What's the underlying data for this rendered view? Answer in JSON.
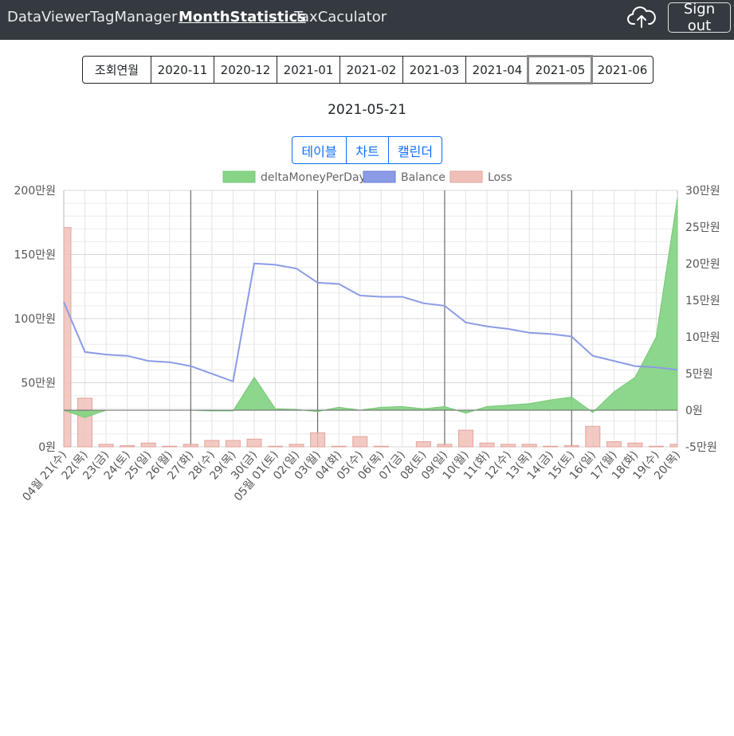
{
  "nav": {
    "links": [
      "DataViewer",
      "TagManager",
      "MonthStatistics",
      "TaxCaculator"
    ],
    "active": "MonthStatistics",
    "upload_icon": "cloud-upload-icon",
    "signout_label": "Sign out"
  },
  "months": {
    "label": "조회연월",
    "items": [
      "2020-11",
      "2020-12",
      "2021-01",
      "2021-02",
      "2021-03",
      "2021-04",
      "2021-05",
      "2021-06"
    ],
    "selected": "2021-05"
  },
  "date_title": "2021-05-21",
  "view_tabs": [
    "테이블",
    "차트",
    "캘린더"
  ],
  "colors": {
    "navbar": "#343a40",
    "delta": "#87d487",
    "balance": "#8b9be6",
    "loss": "#f0c0b8",
    "link": "#0d6efd"
  },
  "chart_data": {
    "type": "line",
    "categories": [
      "04월 21(수)",
      "22(목)",
      "23(금)",
      "24(토)",
      "25(일)",
      "26(월)",
      "27(화)",
      "28(수)",
      "29(목)",
      "30(금)",
      "05월 01(토)",
      "02(일)",
      "03(월)",
      "04(화)",
      "05(수)",
      "06(목)",
      "07(금)",
      "08(토)",
      "09(일)",
      "10(월)",
      "11(화)",
      "12(수)",
      "13(목)",
      "14(금)",
      "15(토)",
      "16(일)",
      "17(월)",
      "18(화)",
      "19(수)",
      "20(목)"
    ],
    "legend": [
      "deltaMoneyPerDay",
      "Balance",
      "Loss"
    ],
    "legend_position": "top",
    "left_axis": {
      "ticks": [
        "0원",
        "50만원",
        "100만원",
        "150만원",
        "200만원"
      ],
      "range": [
        0,
        200
      ]
    },
    "right_axis": {
      "ticks": [
        "-5만원",
        "0원",
        "5만원",
        "10만원",
        "15만원",
        "20만원",
        "25만원",
        "30만원"
      ],
      "range": [
        -5,
        30
      ]
    },
    "series": [
      {
        "name": "deltaMoneyPerDay",
        "type": "area",
        "axis": "right",
        "unit": "만원",
        "values": [
          0,
          -1,
          0,
          0,
          0,
          0,
          0,
          -0.1,
          -0.1,
          4.5,
          0.2,
          0.1,
          -0.2,
          0.4,
          0,
          0.4,
          0.5,
          0.2,
          0.5,
          -0.4,
          0.5,
          0.7,
          0.9,
          1.4,
          1.8,
          -0.3,
          2.5,
          4.5,
          10,
          29
        ]
      },
      {
        "name": "Balance",
        "type": "line",
        "axis": "left",
        "unit": "만원",
        "values": [
          113,
          74,
          72,
          71,
          67,
          66,
          63,
          57,
          51,
          143,
          142,
          139,
          128,
          127,
          118,
          117,
          117,
          112,
          110,
          97,
          94,
          92,
          89,
          88,
          86,
          71,
          67,
          63,
          62,
          60
        ]
      },
      {
        "name": "Loss",
        "type": "bar",
        "axis": "left",
        "unit": "만원",
        "values": [
          171,
          38,
          2,
          1,
          3,
          0.5,
          2,
          5,
          5,
          6,
          0.5,
          2,
          11,
          0.5,
          8,
          0.5,
          0,
          4,
          2,
          13,
          3,
          2,
          2,
          0.5,
          1,
          16,
          4,
          3,
          0.5,
          2
        ]
      }
    ],
    "month_boundary_lines_after": [
      "27(화)",
      "03(월)",
      "09(일)",
      "15(토)"
    ]
  }
}
